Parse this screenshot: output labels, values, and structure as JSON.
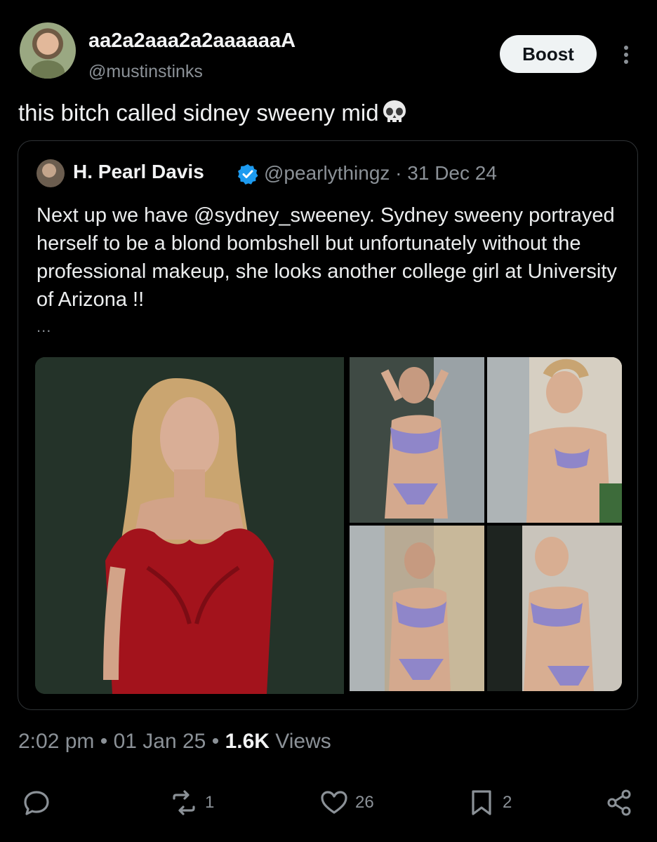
{
  "post": {
    "display_name": "aa2a2aaa2a2aaaaaaA",
    "handle": "@mustinstinks",
    "boost_label": "Boost",
    "text": "this bitch called sidney sweeny mid"
  },
  "quote": {
    "name": "H. Pearl Davis",
    "handle_date": "@pearlythingz · 31 Dec 24",
    "text": "Next up we have @sydney_sweeney. Sydney sweeny portrayed herself to be a blond bombshell but unfortunately without the professional makeup, she looks another college girl at University of Arizona !!",
    "ellipsis": "..."
  },
  "meta": {
    "time": "2:02 pm",
    "sep1": " • ",
    "date": "01 Jan 25",
    "sep2": " • ",
    "views_count": "1.6K",
    "views_label": " Views"
  },
  "actions": {
    "reposts": "1",
    "likes": "26",
    "bookmarks": "2"
  },
  "colors": {
    "background": "#000000",
    "text": "#e7e9ea",
    "muted": "#8b9197",
    "verified": "#1d9bf0",
    "dress": "#a3131c",
    "swimsuit": "#8f86c9"
  },
  "icons": [
    "more-icon",
    "skull-icon",
    "verified-icon",
    "reply-icon",
    "repost-icon",
    "like-icon",
    "bookmark-icon",
    "share-icon"
  ]
}
